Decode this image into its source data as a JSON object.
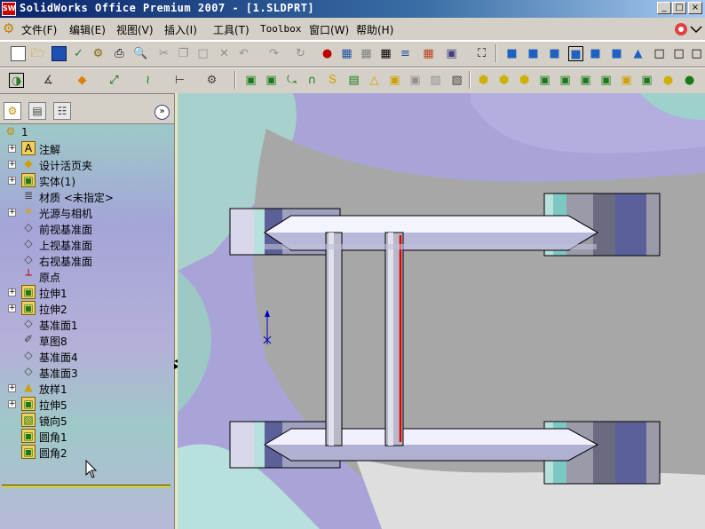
{
  "window": {
    "title": "SolidWorks Office Premium 2007 - [1.SLDPRT]",
    "app_icon_label": "SW",
    "controls": [
      "_",
      "□",
      "×"
    ]
  },
  "menubar": {
    "items": [
      "文件(F)",
      "编辑(E)",
      "视图(V)",
      "插入(I)",
      "工具(T)",
      "Toolbox",
      "窗口(W)",
      "帮助(H)"
    ]
  },
  "feature_manager": {
    "tabs": [
      "feature-manager",
      "property-manager",
      "configuration-manager"
    ],
    "root_label": "1",
    "items": [
      {
        "label": "注解",
        "icon": "annotation-icon",
        "expandable": true
      },
      {
        "label": "设计活页夹",
        "icon": "design-binder-icon",
        "expandable": true
      },
      {
        "label": "实体(1)",
        "icon": "solid-bodies-icon",
        "expandable": true
      },
      {
        "label": "材质 <未指定>",
        "icon": "material-icon",
        "expandable": false
      },
      {
        "label": "光源与相机",
        "icon": "lights-cameras-icon",
        "expandable": true
      },
      {
        "label": "前视基准面",
        "icon": "plane-icon",
        "expandable": false
      },
      {
        "label": "上视基准面",
        "icon": "plane-icon",
        "expandable": false
      },
      {
        "label": "右视基准面",
        "icon": "plane-icon",
        "expandable": false
      },
      {
        "label": "原点",
        "icon": "origin-icon",
        "expandable": false
      },
      {
        "label": "拉伸1",
        "icon": "extrude-icon",
        "expandable": true
      },
      {
        "label": "拉伸2",
        "icon": "extrude-icon",
        "expandable": true
      },
      {
        "label": "基准面1",
        "icon": "plane-icon",
        "expandable": false
      },
      {
        "label": "草图8",
        "icon": "sketch-icon",
        "expandable": false
      },
      {
        "label": "基准面4",
        "icon": "plane-icon",
        "expandable": false
      },
      {
        "label": "基准面3",
        "icon": "plane-icon",
        "expandable": false
      },
      {
        "label": "放样1",
        "icon": "loft-icon",
        "expandable": true
      },
      {
        "label": "拉伸5",
        "icon": "extrude-icon",
        "expandable": true
      },
      {
        "label": "镜向5",
        "icon": "mirror-icon",
        "expandable": false
      },
      {
        "label": "圆角1",
        "icon": "fillet-icon",
        "expandable": false
      },
      {
        "label": "圆角2",
        "icon": "fillet-icon",
        "expandable": false
      }
    ]
  },
  "colors": {
    "title_bar": "#0a246a",
    "viewport_bg": "#a8a4d8",
    "selected_edge": "#e00000",
    "rollback_bar": "#e0d000"
  }
}
